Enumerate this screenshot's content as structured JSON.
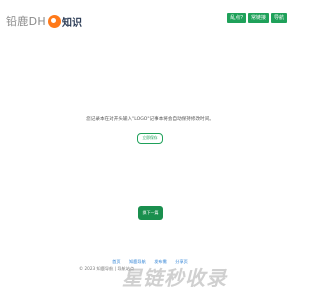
{
  "header": {
    "logo_text": "铅鹿DH",
    "logo_strong": "知识",
    "nav": [
      "乱点?",
      "常链接",
      "导航"
    ]
  },
  "record": {
    "text": "您记录本在对开头输入\"LOGO\"记事本将会自动保持修改时间。",
    "submit_label": "立即保存"
  },
  "next_label": "换下一篇",
  "footer": {
    "links": [
      "首页",
      "知鹿导航",
      "发布需",
      "分享页"
    ],
    "copyright": "© 2023 知鹿导航 | 导航站点"
  },
  "watermark": "星链秒收录",
  "colors": {
    "accent": "#1fa15a",
    "logo_orange": "#ff7a1a",
    "link_blue": "#2a7fd4"
  }
}
